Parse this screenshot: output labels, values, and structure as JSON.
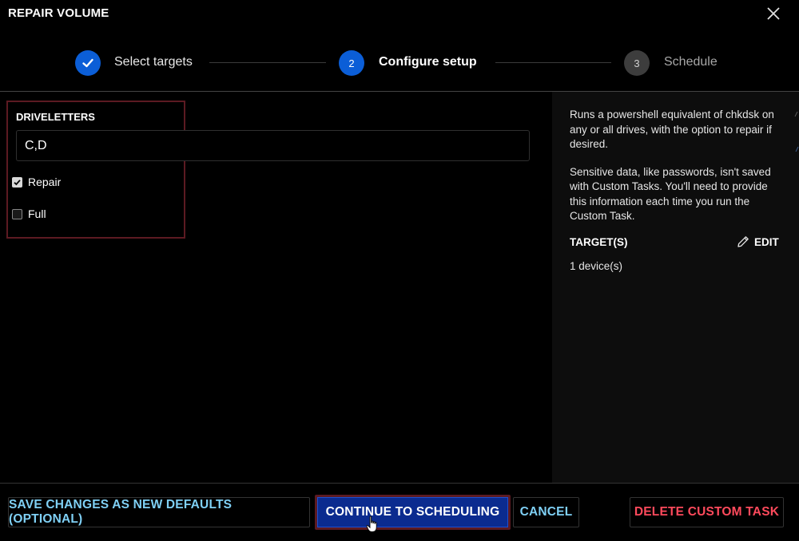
{
  "dialog": {
    "title": "REPAIR VOLUME"
  },
  "stepper": {
    "steps": [
      {
        "number": "",
        "label": "Select targets",
        "state": "completed"
      },
      {
        "number": "2",
        "label": "Configure setup",
        "state": "active"
      },
      {
        "number": "3",
        "label": "Schedule",
        "state": "pending"
      }
    ]
  },
  "form": {
    "field_label": "DRIVELETTERS",
    "driveletters_value": "C,D",
    "repair": {
      "label": "Repair",
      "checked": true
    },
    "full": {
      "label": "Full",
      "checked": false
    }
  },
  "side_panel": {
    "description_1": "Runs a powershell equivalent of chkdsk on any or all drives, with the option to repair if desired.",
    "description_2": "Sensitive data, like passwords, isn't saved with Custom Tasks. You'll need to provide this information each time you run the Custom Task.",
    "targets_label": "TARGET(S)",
    "edit_label": "EDIT",
    "targets_count": "1 device(s)"
  },
  "footer": {
    "save_label": "SAVE CHANGES AS NEW DEFAULTS (OPTIONAL)",
    "continue_label": "CONTINUE TO SCHEDULING",
    "cancel_label": "CANCEL",
    "delete_label": "DELETE CUSTOM TASK"
  },
  "colors": {
    "active_step": "#0b5ed7",
    "pending_step": "#3d3d3d",
    "link_blue": "#7fd0f5",
    "danger_red": "#ff4a5c",
    "primary_button": "#0b2b8f"
  },
  "icons": {
    "close": "close-icon",
    "check": "checkmark-icon",
    "edit": "pencil-icon",
    "cursor": "hand-pointer-icon"
  }
}
